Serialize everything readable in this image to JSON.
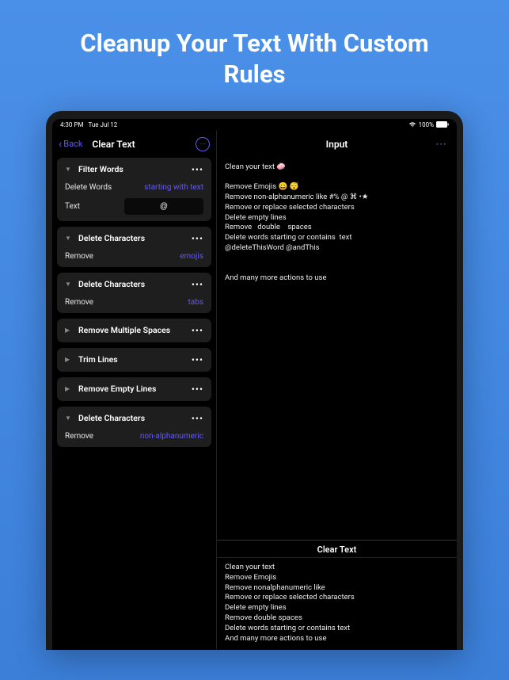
{
  "promo": {
    "headline": "Cleanup Your Text With\nCustom Rules"
  },
  "statusBar": {
    "time": "4:30 PM",
    "date": "Tue Jul 12",
    "battery": "100%"
  },
  "nav": {
    "back": "Back",
    "title": "Clear Text"
  },
  "rules": [
    {
      "title": "Filter Words",
      "expanded": true,
      "rows": [
        {
          "label": "Delete Words",
          "value": "starting with text",
          "type": "value"
        },
        {
          "label": "Text",
          "input": "@",
          "type": "input"
        }
      ]
    },
    {
      "title": "Delete Characters",
      "expanded": true,
      "rows": [
        {
          "label": "Remove",
          "value": "emojis",
          "type": "value"
        }
      ]
    },
    {
      "title": "Delete Characters",
      "expanded": true,
      "rows": [
        {
          "label": "Remove",
          "value": "tabs",
          "type": "value"
        }
      ]
    },
    {
      "title": "Remove Multiple Spaces",
      "expanded": false,
      "rows": []
    },
    {
      "title": "Trim Lines",
      "expanded": false,
      "rows": []
    },
    {
      "title": "Remove Empty Lines",
      "expanded": false,
      "rows": []
    },
    {
      "title": "Delete Characters",
      "expanded": true,
      "rows": [
        {
          "label": "Remove",
          "value": "non-alphanumeric",
          "type": "value"
        }
      ]
    }
  ],
  "rightPane": {
    "inputTitle": "Input",
    "inputText": "Clean your text 🧼\n\nRemove Emojis 😀 😴\nRemove non-alphanumeric like #% @ ⌘ •★\nRemove or replace selected characters\nDelete empty lines\nRemove   double    spaces\nDelete words starting or contains  text\n@deleteThisWord @andThis\n\n\nAnd many more actions to use",
    "outputTitle": "Clear Text",
    "outputText": "Clean your text\nRemove Emojis\nRemove nonalphanumeric like\nRemove or replace selected characters\nDelete empty lines\nRemove double spaces\nDelete words starting or contains text\nAnd many more actions to use"
  }
}
